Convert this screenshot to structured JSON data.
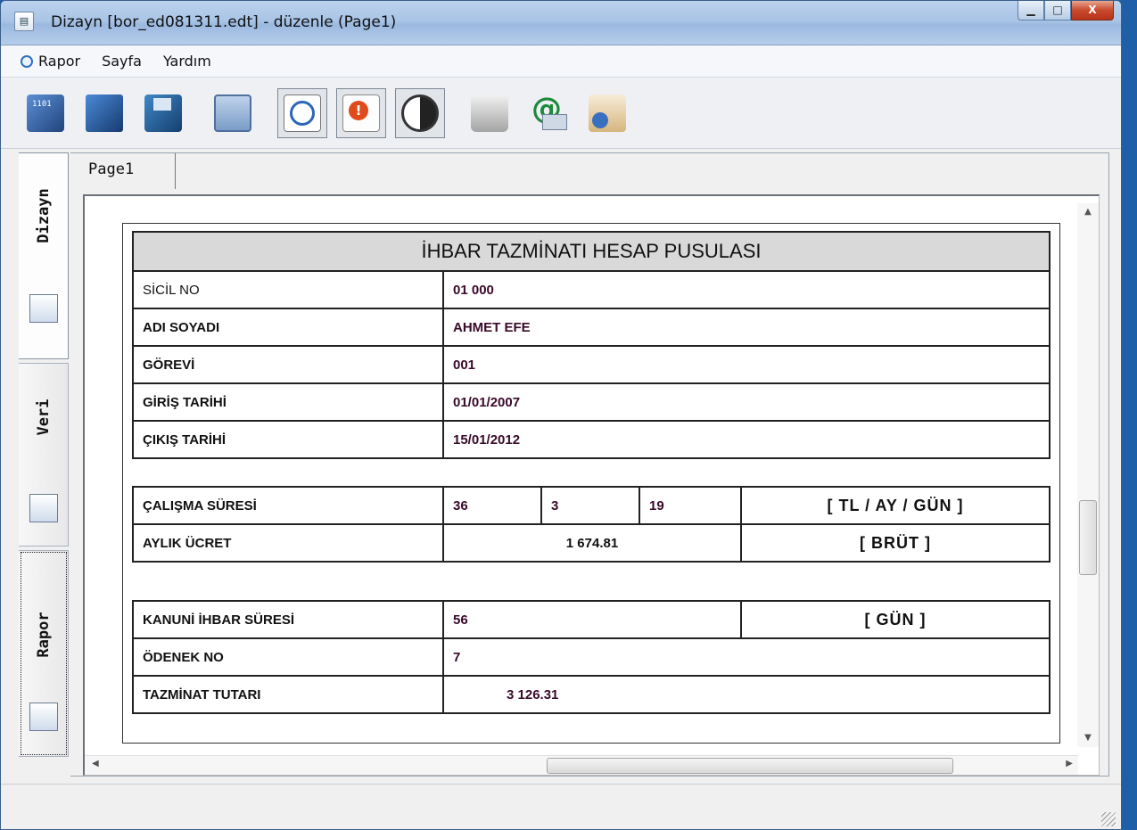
{
  "window": {
    "title": "Dizayn  [bor_ed081311.edt] - düzenle (Page1)",
    "controls": {
      "minimize": "▁",
      "maximize": "□",
      "close": "X"
    }
  },
  "menu": {
    "items": [
      "Rapor",
      "Sayfa",
      "Yardım"
    ]
  },
  "toolbar": {
    "buttons": [
      "data-icon",
      "cabinet-icon",
      "save-disk-icon",
      "layout-icon",
      "preview-icon",
      "warning-icon",
      "contrast-icon",
      "printer-icon",
      "email-icon",
      "exit-icon"
    ],
    "pressed": [
      "preview-icon",
      "warning-icon",
      "contrast-icon"
    ]
  },
  "side_tabs": [
    {
      "label": "Dizayn",
      "active": true
    },
    {
      "label": "Veri",
      "active": false
    },
    {
      "label": "Rapor",
      "active": false
    }
  ],
  "page_tab": "Page1",
  "report": {
    "title": "İHBAR TAZMİNATI HESAP PUSULASI",
    "personal": [
      {
        "label": "SİCİL NO",
        "value": "01 000"
      },
      {
        "label": "ADI SOYADI",
        "value": "AHMET EFE"
      },
      {
        "label": "GÖREVİ",
        "value": "001"
      },
      {
        "label": "GİRİŞ TARİHİ",
        "value": "01/01/2007"
      },
      {
        "label": "ÇIKIŞ TARİHİ",
        "value": "15/01/2012"
      }
    ],
    "work": {
      "duration_label": "ÇALIŞMA SÜRESİ",
      "duration_values": [
        "36",
        "3",
        "19"
      ],
      "duration_unit": "[  TL  /  AY  /  GÜN  ]",
      "salary_label": "AYLIK ÜCRET",
      "salary_value": "1 674.81",
      "salary_unit": "[  BRÜT  ]"
    },
    "notice": {
      "period_label": "KANUNİ İHBAR SÜRESİ",
      "period_value": "56",
      "period_unit": "[  GÜN  ]",
      "allowance_label": "ÖDENEK NO",
      "allowance_value": "7",
      "amount_label": "TAZMİNAT TUTARI",
      "amount_value": "3 126.31"
    }
  }
}
